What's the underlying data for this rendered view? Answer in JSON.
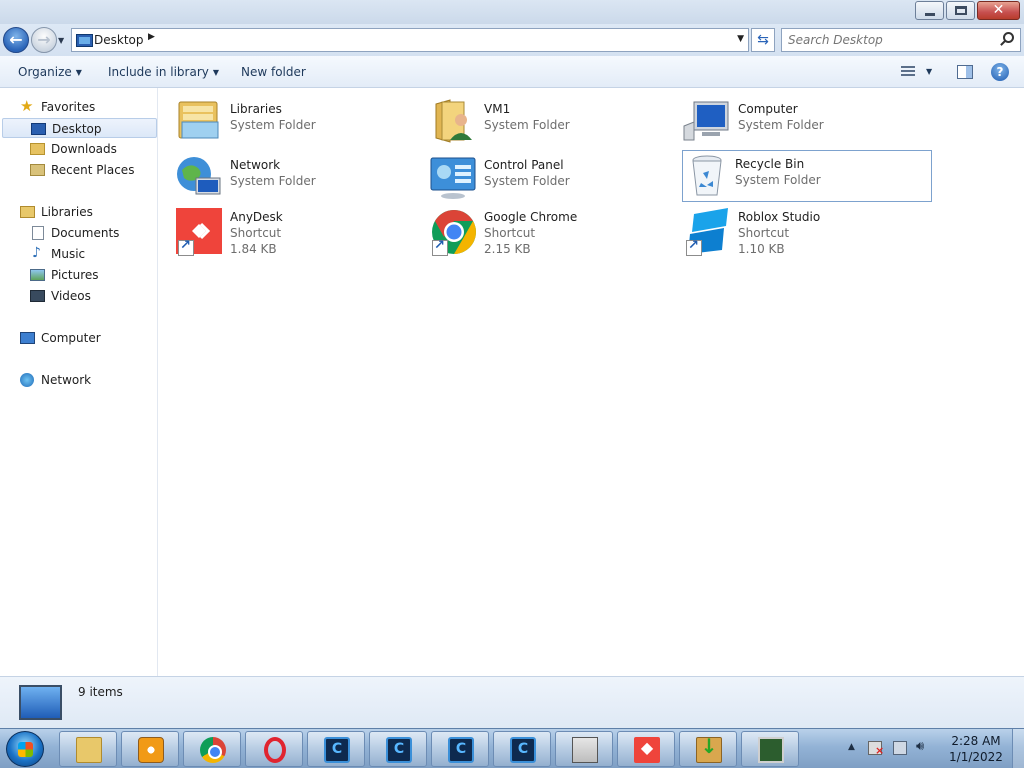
{
  "address": {
    "location": "Desktop"
  },
  "search": {
    "placeholder": "Search Desktop"
  },
  "toolbar": {
    "organize": "Organize",
    "include_in_library": "Include in library",
    "new_folder": "New folder"
  },
  "nav": {
    "favorites": "Favorites",
    "desktop": "Desktop",
    "downloads": "Downloads",
    "recent_places": "Recent Places",
    "libraries": "Libraries",
    "documents": "Documents",
    "music": "Music",
    "pictures": "Pictures",
    "videos": "Videos",
    "computer": "Computer",
    "network": "Network"
  },
  "items": [
    {
      "name": "Libraries",
      "type": "System Folder",
      "icon": "libraries-icon"
    },
    {
      "name": "VM1",
      "type": "System Folder",
      "icon": "user-folder-icon"
    },
    {
      "name": "Computer",
      "type": "System Folder",
      "icon": "computer-icon"
    },
    {
      "name": "Network",
      "type": "System Folder",
      "icon": "network-icon"
    },
    {
      "name": "Control Panel",
      "type": "System Folder",
      "icon": "control-panel-icon"
    },
    {
      "name": "Recycle Bin",
      "type": "System Folder",
      "icon": "recycle-bin-icon"
    },
    {
      "name": "AnyDesk",
      "type": "Shortcut",
      "size": "1.84 KB",
      "icon": "anydesk-icon"
    },
    {
      "name": "Google Chrome",
      "type": "Shortcut",
      "size": "2.15 KB",
      "icon": "chrome-icon"
    },
    {
      "name": "Roblox Studio",
      "type": "Shortcut",
      "size": "1.10 KB",
      "icon": "roblox-studio-icon"
    }
  ],
  "status": {
    "count": "9 items"
  },
  "taskbar": {
    "apps": [
      "explorer",
      "media-player",
      "chrome",
      "opera",
      "app-c-1",
      "app-c-2",
      "app-c-3",
      "app-c-4",
      "network-tool",
      "anydesk",
      "installer",
      "remote-desktop"
    ]
  },
  "clock": {
    "time": "2:28 AM",
    "date": "1/1/2022"
  },
  "colors": {
    "accent": "#2a64b8",
    "selection_border": "#7da2ce",
    "anydesk": "#ef443b"
  }
}
